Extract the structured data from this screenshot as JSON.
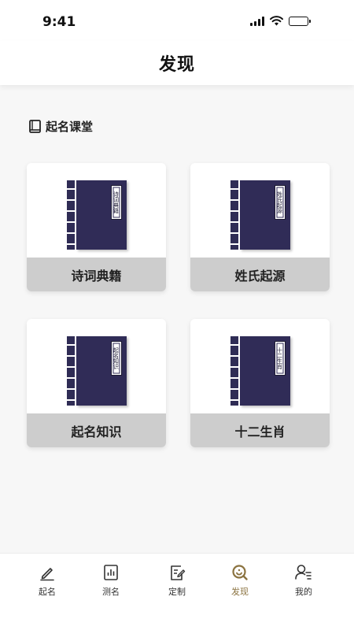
{
  "status_bar": {
    "time": "9:41"
  },
  "header": {
    "title": "发现"
  },
  "section": {
    "title": "起名课堂"
  },
  "cards": [
    {
      "label": "诗词典籍",
      "book_title": "诗词典籍"
    },
    {
      "label": "姓氏起源",
      "book_title": "姓氏起源"
    },
    {
      "label": "起名知识",
      "book_title": "起名知识"
    },
    {
      "label": "十二生肖",
      "book_title": "十二生肖"
    }
  ],
  "tab_bar": {
    "items": [
      {
        "label": "起名",
        "icon": "pen-icon"
      },
      {
        "label": "测名",
        "icon": "chart-icon"
      },
      {
        "label": "定制",
        "icon": "edit-doc-icon"
      },
      {
        "label": "发现",
        "icon": "discover-icon",
        "active": true
      },
      {
        "label": "我的",
        "icon": "user-icon"
      }
    ]
  },
  "colors": {
    "book_cover": "#302c57",
    "card_label_bg": "#cdcdcd",
    "active_tab": "#8b7340",
    "page_bg": "#f7f7f7"
  }
}
